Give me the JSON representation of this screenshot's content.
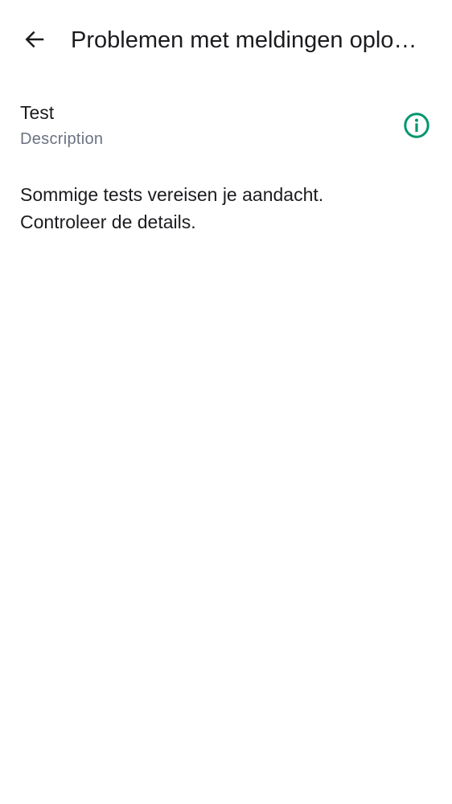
{
  "header": {
    "back_icon": "arrow-back-icon",
    "title": "Problemen met meldingen oplo…"
  },
  "test_item": {
    "title": "Test",
    "description": "Description",
    "status_icon": "info-circle-icon",
    "status_color": "#00966e"
  },
  "status_message": {
    "line1": "Sommige tests vereisen je aandacht.",
    "line2": "Controleer de details."
  }
}
